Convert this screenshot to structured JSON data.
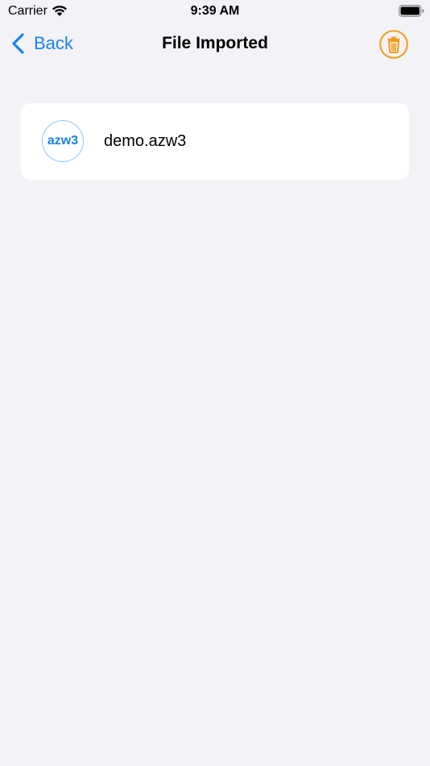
{
  "status_bar": {
    "carrier": "Carrier",
    "time": "9:39 AM",
    "wifi_icon": "wifi-icon",
    "battery_icon": "battery-icon"
  },
  "nav": {
    "back_label": "Back",
    "title": "File Imported",
    "trash_icon": "trash-icon",
    "accent_color": "#1a82f0",
    "trash_color": "#f49b16"
  },
  "files": [
    {
      "badge": "azw3",
      "name": "demo.azw3"
    }
  ],
  "colors": {
    "background": "#f2f2f7",
    "card": "#ffffff",
    "badge_border": "#95c4f2"
  }
}
